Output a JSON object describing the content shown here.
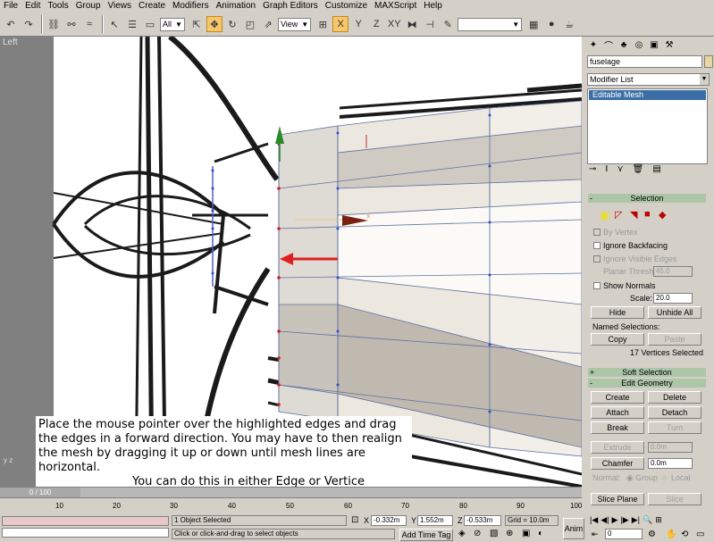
{
  "menubar": [
    "File",
    "Edit",
    "Tools",
    "Group",
    "Views",
    "Create",
    "Modifiers",
    "Animation",
    "Graph Editors",
    "Customize",
    "MAXScript",
    "Help"
  ],
  "toolbar": {
    "selection_filter": "All",
    "reference_coord": "View",
    "snap_percent": ""
  },
  "viewport": {
    "label": "Left",
    "axis_label": "y z",
    "callout_line1": "Place the mouse pointer over the highlighted edges and drag the edges in a forward direction.  You may have to then realign the mesh by dragging it up or down until mesh lines are horizontal.",
    "callout_line2": "You can do this in either Edge or Vertice modes."
  },
  "panel": {
    "object_name": "fuselage",
    "modifier_list": "Modifier List",
    "stack_item": "Editable Mesh",
    "selection": {
      "title": "Selection",
      "by_vertex": "By Vertex",
      "ignore_backfacing": "Ignore Backfacing",
      "ignore_visible_edges": "Ignore Visible Edges",
      "planar_thresh": "Planar Thresh:",
      "planar_value": "45.0",
      "show_normals": "Show Normals",
      "scale_label": "Scale:",
      "scale_value": "20.0",
      "hide": "Hide",
      "unhide_all": "Unhide All",
      "named_selections": "Named Selections:",
      "copy": "Copy",
      "paste": "Paste",
      "status": "17 Vertices Selected"
    },
    "soft_selection": "Soft Selection",
    "edit_geometry": {
      "title": "Edit Geometry",
      "create": "Create",
      "delete": "Delete",
      "attach": "Attach",
      "detach": "Detach",
      "break": "Break",
      "turn": "Turn",
      "extrude": "Extrude",
      "extrude_value": "0.0m",
      "chamfer": "Chamfer",
      "chamfer_value": "0.0m",
      "normal": "Normal:",
      "group": "Group",
      "local": "Local",
      "slice_plane": "Slice Plane",
      "slice": "Slice"
    }
  },
  "timeline": {
    "frame": "0 / 100",
    "ticks": [
      "10",
      "20",
      "30",
      "40",
      "50",
      "60",
      "70",
      "80",
      "90",
      "100"
    ]
  },
  "status": {
    "objects": "1 Object Selected",
    "prompt": "Click or click-and-drag to select objects",
    "x_label": "X",
    "x_value": "-0.332m",
    "y_label": "Y",
    "y_value": "1.552m",
    "z_label": "Z",
    "z_value": "-0.533m",
    "grid": "Grid = 10.0m",
    "add_time_tag": "Add Time Tag",
    "anim": "Anim",
    "frame_field": "0"
  }
}
